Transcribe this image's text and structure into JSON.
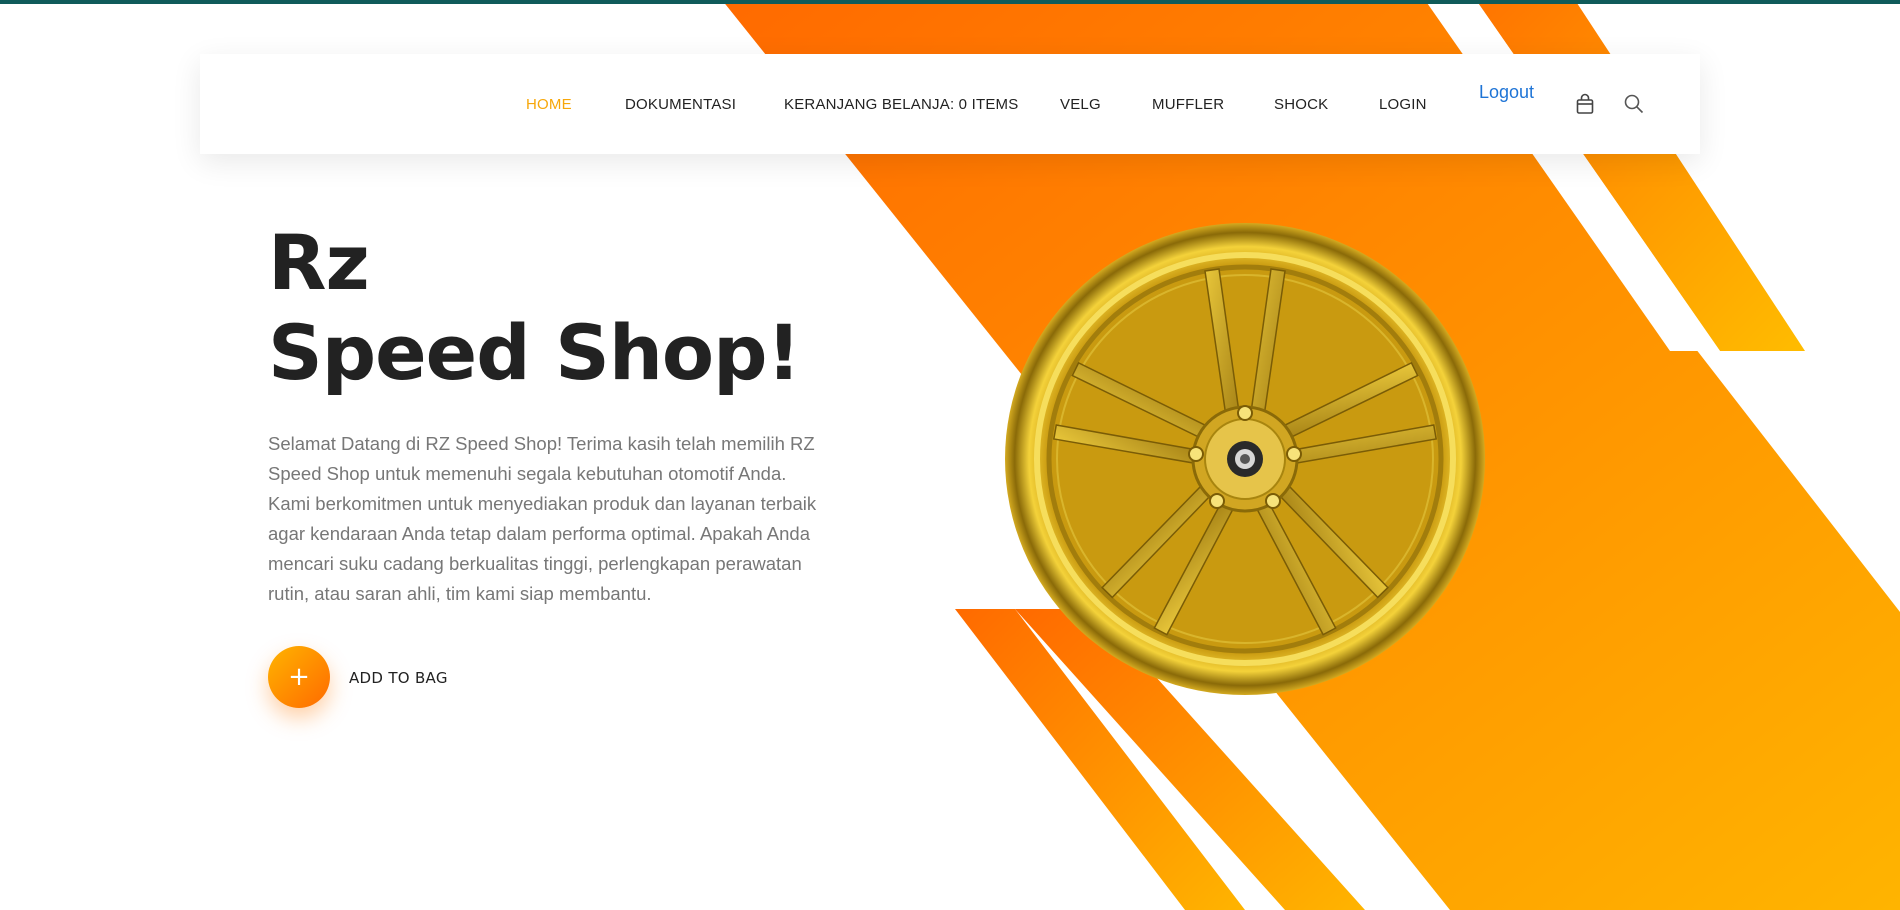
{
  "nav": {
    "items": [
      {
        "label": "HOME",
        "active": true
      },
      {
        "label": "DOKUMENTASI",
        "active": false
      },
      {
        "label": "KERANJANG BELANJA: 0 ITEMS",
        "active": false
      },
      {
        "label": "VELG",
        "active": false
      },
      {
        "label": "MUFFLER",
        "active": false
      },
      {
        "label": "SHOCK",
        "active": false
      },
      {
        "label": "LOGIN",
        "active": false
      }
    ],
    "logout": "Logout",
    "icons": [
      "shopping-bag-icon",
      "search-icon"
    ]
  },
  "hero": {
    "title_line1": "Rz",
    "title_line2": "Speed Shop!",
    "description": "Selamat Datang di RZ Speed Shop! Terima kasih telah memilih RZ Speed Shop untuk memenuhi segala kebutuhan otomotif Anda. Kami berkomitmen untuk menyediakan produk dan layanan terbaik agar kendaraan Anda tetap dalam performa optimal. Apakah Anda mencari suku cadang berkualitas tinggi, perlengkapan perawatan rutin, atau saran ahli, tim kami siap membantu.",
    "add_button_symbol": "+",
    "add_label": "ADD TO BAG"
  },
  "colors": {
    "accent_orange": "#ff6a00",
    "accent_yellow": "#ffb400",
    "active_nav": "#f7a70a",
    "logout_link": "#1e74d6",
    "top_strip": "#0f5b5a"
  }
}
